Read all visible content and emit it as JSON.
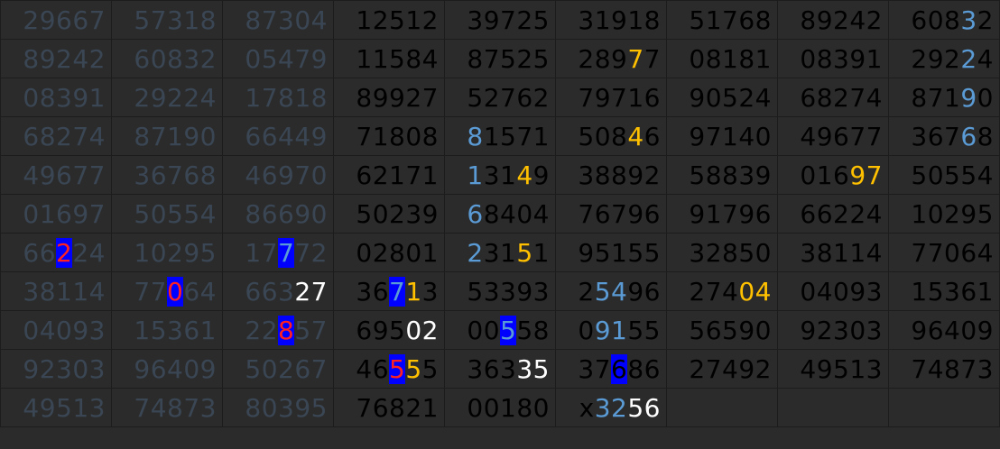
{
  "rows": [
    [
      [
        [
          "29667"
        ]
      ],
      [
        [
          "57318"
        ]
      ],
      [
        [
          "87304"
        ]
      ],
      [
        [
          "12512"
        ]
      ],
      [
        [
          "39725"
        ]
      ],
      [
        [
          "31918"
        ]
      ],
      [
        [
          "51768"
        ]
      ],
      [
        [
          "89242"
        ]
      ],
      [
        [
          "608",
          ""
        ],
        [
          "3",
          "blue"
        ],
        [
          "2",
          ""
        ]
      ]
    ],
    [
      [
        [
          "89242"
        ]
      ],
      [
        [
          "60832"
        ]
      ],
      [
        [
          "05479"
        ]
      ],
      [
        [
          "11584"
        ]
      ],
      [
        [
          "87525"
        ]
      ],
      [
        [
          "289",
          ""
        ],
        [
          "7",
          "orange"
        ],
        [
          "7",
          ""
        ]
      ],
      [
        [
          "08181"
        ]
      ],
      [
        [
          "08391"
        ]
      ],
      [
        [
          "292",
          ""
        ],
        [
          "2",
          "blue"
        ],
        [
          "4",
          ""
        ]
      ]
    ],
    [
      [
        [
          "08391"
        ]
      ],
      [
        [
          "29224"
        ]
      ],
      [
        [
          "17818"
        ]
      ],
      [
        [
          "89927"
        ]
      ],
      [
        [
          "52762"
        ]
      ],
      [
        [
          "79716"
        ]
      ],
      [
        [
          "90524"
        ]
      ],
      [
        [
          "68274"
        ]
      ],
      [
        [
          "871",
          ""
        ],
        [
          "9",
          "blue"
        ],
        [
          "0",
          ""
        ]
      ]
    ],
    [
      [
        [
          "68274"
        ]
      ],
      [
        [
          "87190"
        ]
      ],
      [
        [
          "66449"
        ]
      ],
      [
        [
          "71808"
        ]
      ],
      [
        [
          "8",
          "blue"
        ],
        [
          "1571",
          ""
        ]
      ],
      [
        [
          "508",
          ""
        ],
        [
          "4",
          "orange"
        ],
        [
          "6",
          ""
        ]
      ],
      [
        [
          "97140"
        ]
      ],
      [
        [
          "49677"
        ]
      ],
      [
        [
          "367",
          ""
        ],
        [
          "6",
          "blue"
        ],
        [
          "8",
          ""
        ]
      ]
    ],
    [
      [
        [
          "49677"
        ]
      ],
      [
        [
          "36768"
        ]
      ],
      [
        [
          "46970"
        ]
      ],
      [
        [
          "62171"
        ]
      ],
      [
        [
          "1",
          "blue"
        ],
        [
          "31",
          ""
        ],
        [
          "4",
          "orange"
        ],
        [
          "9",
          ""
        ]
      ],
      [
        [
          "38892"
        ]
      ],
      [
        [
          "58839"
        ]
      ],
      [
        [
          "016",
          ""
        ],
        [
          "97",
          "orange"
        ]
      ],
      [
        [
          "50554"
        ]
      ]
    ],
    [
      [
        [
          "01697"
        ]
      ],
      [
        [
          "50554"
        ]
      ],
      [
        [
          "86690"
        ]
      ],
      [
        [
          "50239"
        ]
      ],
      [
        [
          "6",
          "blue"
        ],
        [
          "8404",
          ""
        ]
      ],
      [
        [
          "76796"
        ]
      ],
      [
        [
          "91796"
        ]
      ],
      [
        [
          "66224"
        ]
      ],
      [
        [
          "10295"
        ]
      ]
    ],
    [
      [
        [
          "66",
          ""
        ],
        [
          "2",
          "redbox"
        ],
        [
          "24",
          ""
        ]
      ],
      [
        [
          "10295"
        ]
      ],
      [
        [
          "17",
          ""
        ],
        [
          "7",
          "bluebox"
        ],
        [
          "72",
          ""
        ]
      ],
      [
        [
          "02801"
        ]
      ],
      [
        [
          "2",
          "blue"
        ],
        [
          "31",
          ""
        ],
        [
          "5",
          "orange"
        ],
        [
          "1",
          ""
        ]
      ],
      [
        [
          "95155"
        ]
      ],
      [
        [
          "32850"
        ]
      ],
      [
        [
          "38114"
        ]
      ],
      [
        [
          "77064"
        ]
      ]
    ],
    [
      [
        [
          "38114"
        ]
      ],
      [
        [
          "77",
          ""
        ],
        [
          "0",
          "redbox"
        ],
        [
          "64",
          ""
        ]
      ],
      [
        [
          "663",
          ""
        ],
        [
          "27",
          "white"
        ]
      ],
      [
        [
          "36",
          ""
        ],
        [
          "7",
          "bluebox"
        ],
        [
          "1",
          "orange"
        ],
        [
          "3",
          ""
        ]
      ],
      [
        [
          "53393"
        ]
      ],
      [
        [
          "2",
          ""
        ],
        [
          "54",
          "blue"
        ],
        [
          "96",
          ""
        ]
      ],
      [
        [
          "274",
          ""
        ],
        [
          "04",
          "orange"
        ]
      ],
      [
        [
          "04093"
        ]
      ],
      [
        [
          "15361"
        ]
      ]
    ],
    [
      [
        [
          "04093"
        ]
      ],
      [
        [
          "15361"
        ]
      ],
      [
        [
          "22",
          ""
        ],
        [
          "8",
          "redbox"
        ],
        [
          "57",
          ""
        ]
      ],
      [
        [
          "695",
          ""
        ],
        [
          "02",
          "white"
        ]
      ],
      [
        [
          "00",
          ""
        ],
        [
          "5",
          "bluebox"
        ],
        [
          "58",
          ""
        ]
      ],
      [
        [
          "0",
          ""
        ],
        [
          "91",
          "blue"
        ],
        [
          "55",
          ""
        ]
      ],
      [
        [
          "56590"
        ]
      ],
      [
        [
          "92303"
        ]
      ],
      [
        [
          "96409"
        ]
      ]
    ],
    [
      [
        [
          "92303"
        ]
      ],
      [
        [
          "96409"
        ]
      ],
      [
        [
          "50267"
        ]
      ],
      [
        [
          "46",
          ""
        ],
        [
          "5",
          "redbox"
        ],
        [
          "5",
          "orange"
        ],
        [
          "5",
          ""
        ]
      ],
      [
        [
          "363",
          ""
        ],
        [
          "35",
          "white"
        ]
      ],
      [
        [
          "37",
          ""
        ],
        [
          "6",
          "blackbox"
        ],
        [
          "86",
          ""
        ]
      ],
      [
        [
          "27492"
        ]
      ],
      [
        [
          "49513"
        ]
      ],
      [
        [
          "74873"
        ]
      ]
    ],
    [
      [
        [
          "49513"
        ]
      ],
      [
        [
          "74873"
        ]
      ],
      [
        [
          "80395"
        ]
      ],
      [
        [
          "76821"
        ]
      ],
      [
        [
          "00180"
        ]
      ],
      [
        [
          "x",
          ""
        ],
        [
          "32",
          "blue"
        ],
        [
          "56",
          "white"
        ]
      ],
      [],
      [],
      []
    ]
  ],
  "colors": {
    "background": "#2b2b2b",
    "dim_text": "#3a4654",
    "text": "#000000",
    "blue": "#5b9bd5",
    "orange": "#ffc000",
    "white": "#ffffff",
    "red": "#ff2020",
    "box": "#0000ff"
  }
}
